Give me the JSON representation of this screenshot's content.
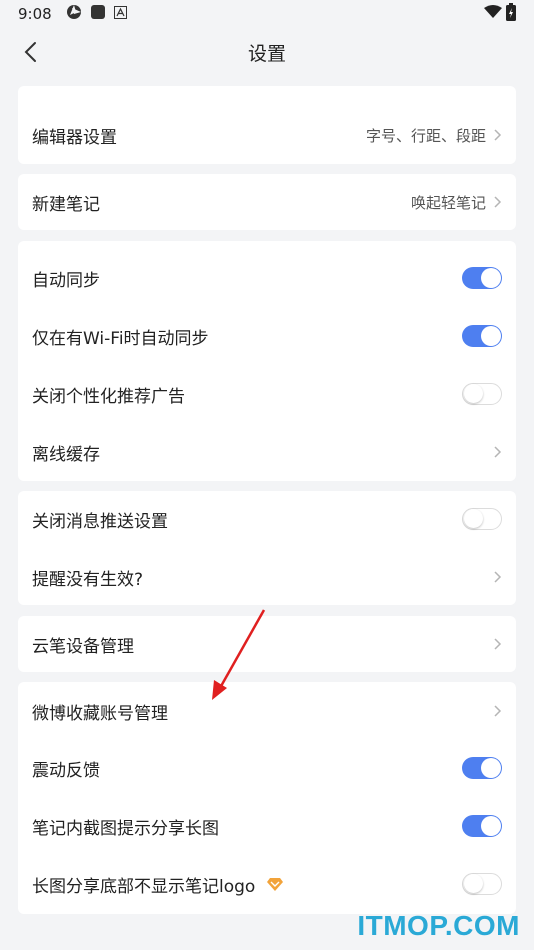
{
  "status_bar": {
    "time": "9:08"
  },
  "header": {
    "title": "设置"
  },
  "sections": {
    "editor": {
      "label": "编辑器设置",
      "value": "字号、行距、段距"
    },
    "new_note": {
      "label": "新建笔记",
      "value": "唤起轻笔记"
    },
    "sync": {
      "auto_sync": {
        "label": "自动同步",
        "on": true
      },
      "wifi_sync": {
        "label": "仅在有Wi-Fi时自动同步",
        "on": true
      },
      "ads": {
        "label": "关闭个性化推荐广告",
        "on": false
      },
      "offline": {
        "label": "离线缓存"
      }
    },
    "push": {
      "close_push": {
        "label": "关闭消息推送设置",
        "on": false
      },
      "reminder": {
        "label": "提醒没有生效?"
      }
    },
    "device": {
      "label": "云笔设备管理"
    },
    "misc": {
      "weibo": {
        "label": "微博收藏账号管理"
      },
      "vibrate": {
        "label": "震动反馈",
        "on": true
      },
      "screenshot_share": {
        "label": "笔记内截图提示分享长图",
        "on": true
      },
      "no_logo": {
        "label": "长图分享底部不显示笔记logo",
        "on": false
      }
    }
  },
  "watermark": "ITMOP.COM",
  "colors": {
    "toggle_on": "#4e7ff0",
    "annotation_arrow": "#e02020",
    "vip_badge": "#f2a33a"
  }
}
